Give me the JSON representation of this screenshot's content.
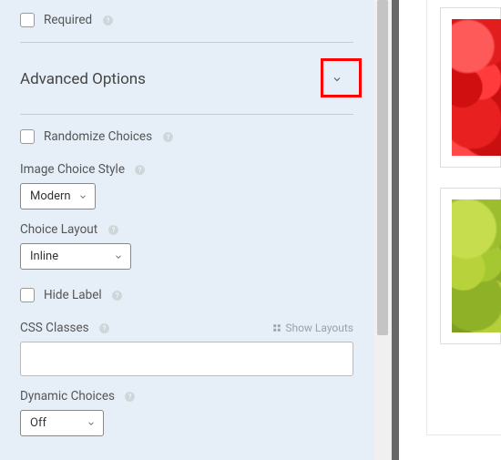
{
  "required": {
    "label": "Required"
  },
  "advanced": {
    "title": "Advanced Options"
  },
  "randomize": {
    "label": "Randomize Choices"
  },
  "imageChoiceStyle": {
    "label": "Image Choice Style",
    "value": "Modern"
  },
  "choiceLayout": {
    "label": "Choice Layout",
    "value": "Inline"
  },
  "hideLabel": {
    "label": "Hide Label"
  },
  "cssClasses": {
    "label": "CSS Classes",
    "showLayouts": "Show Layouts",
    "value": ""
  },
  "dynamicChoices": {
    "label": "Dynamic Choices",
    "value": "Off"
  }
}
